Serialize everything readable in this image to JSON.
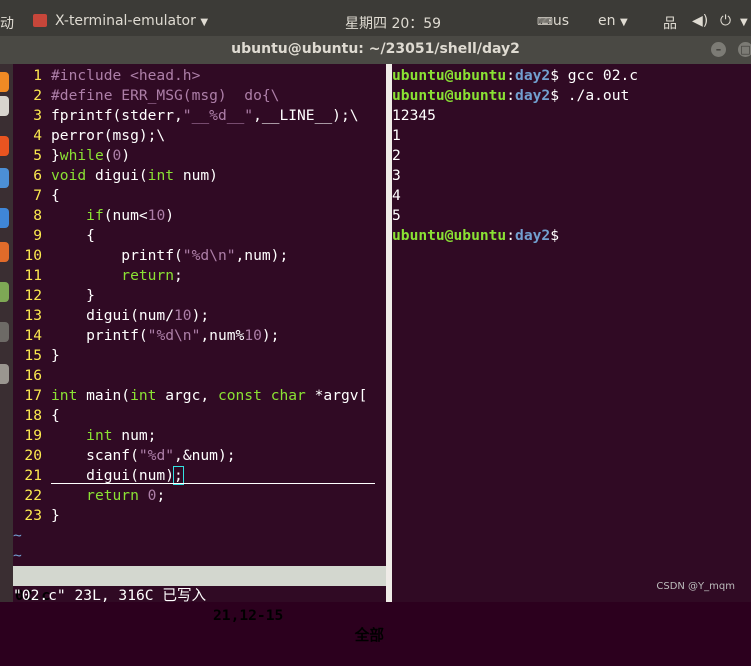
{
  "topbar": {
    "left_label": "动",
    "app_title": "X-terminal-emulator",
    "clock": "星期四 20：59",
    "keyboard": "us",
    "language": "en"
  },
  "window": {
    "title": "ubuntu@ubuntu: ~/23051/shell/day2"
  },
  "vim": {
    "lines": [
      {
        "n": "1",
        "t": "#include <head.h>"
      },
      {
        "n": "2",
        "t": "#define ERR_MSG(msg)  do{\\"
      },
      {
        "n": "3",
        "t": "fprintf(stderr,\"__%d__\",__LINE__);\\"
      },
      {
        "n": "4",
        "t": "perror(msg);\\"
      },
      {
        "n": "5",
        "t": "}while(0)"
      },
      {
        "n": "6",
        "t": "void digui(int num)"
      },
      {
        "n": "7",
        "t": "{"
      },
      {
        "n": "8",
        "t": "    if(num<10)"
      },
      {
        "n": "9",
        "t": "    {"
      },
      {
        "n": "10",
        "t": "        printf(\"%d\\n\",num);"
      },
      {
        "n": "11",
        "t": "        return;"
      },
      {
        "n": "12",
        "t": "    }"
      },
      {
        "n": "13",
        "t": "    digui(num/10);"
      },
      {
        "n": "14",
        "t": "    printf(\"%d\\n\",num%10);"
      },
      {
        "n": "15",
        "t": "}"
      },
      {
        "n": "16",
        "t": ""
      },
      {
        "n": "17",
        "t": "int main(int argc, const char *argv["
      },
      {
        "n": "18",
        "t": "{"
      },
      {
        "n": "19",
        "t": "    int num;"
      },
      {
        "n": "20",
        "t": "    scanf(\"%d\",&num);"
      },
      {
        "n": "21",
        "t": "    digui(num);"
      },
      {
        "n": "22",
        "t": "    return 0;"
      },
      {
        "n": "23",
        "t": "}"
      }
    ],
    "tilde": "~",
    "status_file": "02.c",
    "status_pos": "21,12-15",
    "status_all": "全部",
    "message": "\"02.c\" 23L, 316C 已写入"
  },
  "shell": {
    "prompt_user": "ubuntu@ubuntu",
    "prompt_dir": "day2",
    "cmd1": " gcc 02.c",
    "cmd2": " ./a.out",
    "outputs": [
      "12345",
      "1",
      "2",
      "3",
      "4",
      "5"
    ]
  },
  "watermark": "CSDN @Y_mqm"
}
